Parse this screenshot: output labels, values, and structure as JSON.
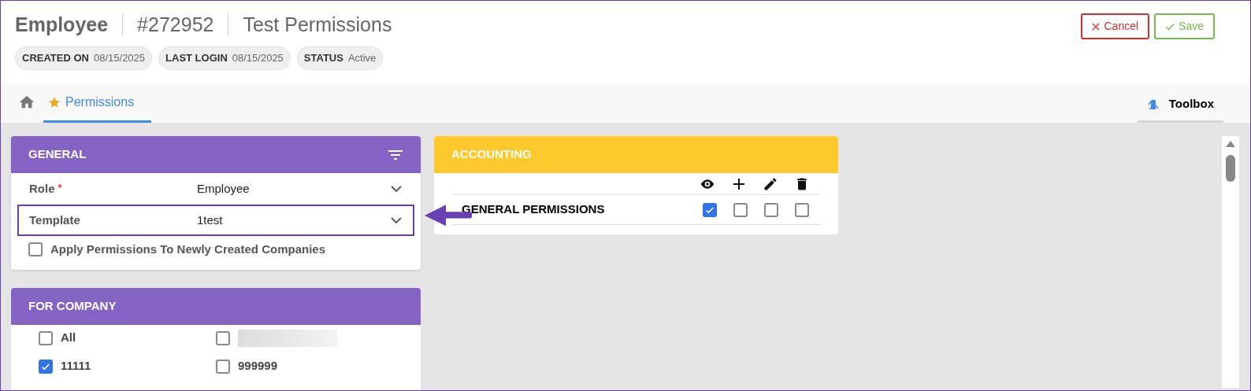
{
  "header": {
    "title": "Employee",
    "id": "#272952",
    "subtitle": "Test Permissions",
    "chips": [
      {
        "label": "CREATED ON",
        "value": "08/15/2025"
      },
      {
        "label": "LAST LOGIN",
        "value": "08/15/2025"
      },
      {
        "label": "STATUS",
        "value": "Active"
      }
    ],
    "buttons": [
      {
        "kind": "cancel",
        "label": "Cancel"
      },
      {
        "kind": "save",
        "label": "Save"
      }
    ]
  },
  "tabs": [
    {
      "label": "Permissions",
      "selected": true
    }
  ],
  "toolbox": {
    "label": "Toolbox"
  },
  "general": {
    "title": "GENERAL",
    "fields": [
      {
        "label": "Role",
        "required_mark": "*",
        "value": "Employee",
        "highlighted": false
      },
      {
        "label": "Template",
        "value": "1test",
        "highlighted": true
      }
    ],
    "apply": {
      "label": "Apply Permissions To Newly Created Companies",
      "checked": false
    }
  },
  "for_company": {
    "title": "FOR COMPANY",
    "items": [
      {
        "kind": "text",
        "label": "All",
        "checked": false
      },
      {
        "kind": "redacted",
        "checked": false
      },
      {
        "kind": "text",
        "label": "11111",
        "checked": true
      },
      {
        "kind": "text",
        "label": "999999",
        "checked": false
      }
    ]
  },
  "accounting": {
    "title": "ACCOUNTING",
    "rows": [
      {
        "label": "GENERAL PERMISSIONS",
        "view": true,
        "add": false,
        "edit": false,
        "delete": false
      }
    ]
  }
}
